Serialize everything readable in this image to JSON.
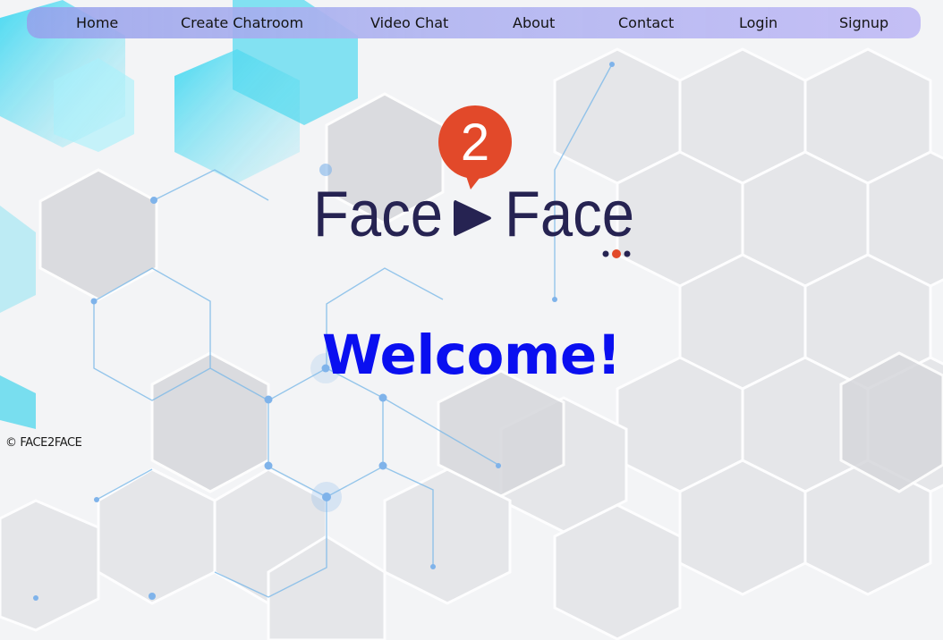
{
  "nav": {
    "items": [
      {
        "label": "Home"
      },
      {
        "label": "Create Chatroom"
      },
      {
        "label": "Video Chat"
      },
      {
        "label": "About"
      },
      {
        "label": "Contact"
      },
      {
        "label": "Login"
      },
      {
        "label": "Signup"
      }
    ]
  },
  "logo": {
    "badge_number": "2",
    "word_left": "Face",
    "word_right": "Face",
    "colors": {
      "text": "#262352",
      "badge": "#e2492a",
      "dot_accent": "#e2492a"
    }
  },
  "hero": {
    "title": "Welcome!",
    "color": "#0a0ff0"
  },
  "footer": {
    "copyright": "© FACE2FACE"
  }
}
